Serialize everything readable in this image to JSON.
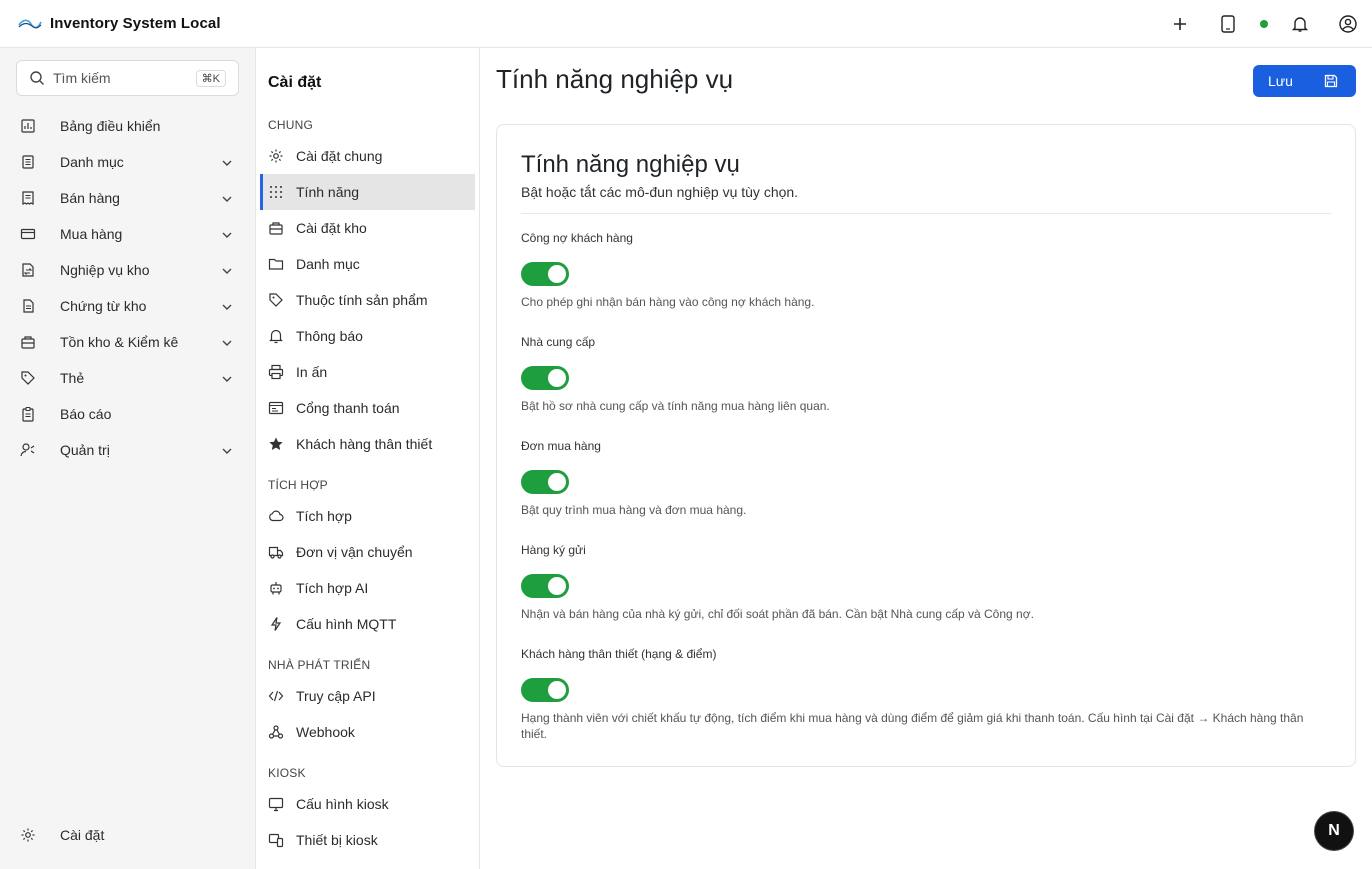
{
  "app": {
    "title": "Inventory System Local"
  },
  "topbar": {
    "icons": [
      "plus-icon",
      "tablet-icon",
      "status-online-dot",
      "bell-icon",
      "user-circle-icon"
    ],
    "status_color": "#1e9e3e"
  },
  "sidebar": {
    "search": {
      "placeholder": "Tìm kiếm",
      "shortcut": "⌘K"
    },
    "items": [
      {
        "label": "Bảng điều khiển",
        "icon": "dashboard-icon",
        "expandable": false
      },
      {
        "label": "Danh mục",
        "icon": "list-icon",
        "expandable": true
      },
      {
        "label": "Bán hàng",
        "icon": "receipt-icon",
        "expandable": true
      },
      {
        "label": "Mua hàng",
        "icon": "credit-card-icon",
        "expandable": true
      },
      {
        "label": "Nghiệp vụ kho",
        "icon": "transfer-icon",
        "expandable": true
      },
      {
        "label": "Chứng từ kho",
        "icon": "document-icon",
        "expandable": true
      },
      {
        "label": "Tồn kho & Kiểm kê",
        "icon": "warehouse-icon",
        "expandable": true
      },
      {
        "label": "Thẻ",
        "icon": "tag-icon",
        "expandable": true
      },
      {
        "label": "Báo cáo",
        "icon": "clipboard-icon",
        "expandable": false
      },
      {
        "label": "Quản trị",
        "icon": "user-settings-icon",
        "expandable": true
      }
    ],
    "footer": {
      "label": "Cài đặt",
      "icon": "gear-icon"
    }
  },
  "settings_nav": {
    "title": "Cài đặt",
    "groups": [
      {
        "label": "CHUNG",
        "items": [
          {
            "label": "Cài đặt chung",
            "icon": "gear-icon",
            "active": false
          },
          {
            "label": "Tính năng",
            "icon": "grid-dots-icon",
            "active": true
          },
          {
            "label": "Cài đặt kho",
            "icon": "warehouse-icon",
            "active": false
          },
          {
            "label": "Danh mục",
            "icon": "folder-icon",
            "active": false
          },
          {
            "label": "Thuộc tính sản phẩm",
            "icon": "tag-icon",
            "active": false
          },
          {
            "label": "Thông báo",
            "icon": "bell-icon",
            "active": false
          },
          {
            "label": "In ấn",
            "icon": "printer-icon",
            "active": false
          },
          {
            "label": "Cổng thanh toán",
            "icon": "payment-gateway-icon",
            "active": false
          },
          {
            "label": "Khách hàng thân thiết",
            "icon": "star-icon",
            "active": false
          }
        ]
      },
      {
        "label": "TÍCH HỢP",
        "items": [
          {
            "label": "Tích hợp",
            "icon": "cloud-icon",
            "active": false
          },
          {
            "label": "Đơn vị vận chuyển",
            "icon": "truck-icon",
            "active": false
          },
          {
            "label": "Tích hợp AI",
            "icon": "robot-icon",
            "active": false
          },
          {
            "label": "Cấu hình MQTT",
            "icon": "lightning-icon",
            "active": false
          }
        ]
      },
      {
        "label": "NHÀ PHÁT TRIỂN",
        "items": [
          {
            "label": "Truy cập API",
            "icon": "code-icon",
            "active": false
          },
          {
            "label": "Webhook",
            "icon": "webhook-icon",
            "active": false
          }
        ]
      },
      {
        "label": "KIOSK",
        "items": [
          {
            "label": "Cấu hình kiosk",
            "icon": "monitor-icon",
            "active": false
          },
          {
            "label": "Thiết bị kiosk",
            "icon": "kiosk-device-icon",
            "active": false
          }
        ]
      }
    ]
  },
  "main": {
    "page_title": "Tính năng nghiệp vụ",
    "save_label": "Lưu",
    "card": {
      "title": "Tính năng nghiệp vụ",
      "description": "Bật hoặc tắt các mô-đun nghiệp vụ tùy chọn.",
      "features": [
        {
          "label": "Công nợ khách hàng",
          "enabled": true,
          "description": "Cho phép ghi nhận bán hàng vào công nợ khách hàng."
        },
        {
          "label": "Nhà cung cấp",
          "enabled": true,
          "description": "Bật hồ sơ nhà cung cấp và tính năng mua hàng liên quan."
        },
        {
          "label": "Đơn mua hàng",
          "enabled": true,
          "description": "Bật quy trình mua hàng và đơn mua hàng."
        },
        {
          "label": "Hàng ký gửi",
          "enabled": true,
          "description": "Nhận và bán hàng của nhà ký gửi, chỉ đối soát phần đã bán. Cần bật Nhà cung cấp và Công nợ."
        },
        {
          "label": "Khách hàng thân thiết (hạng & điểm)",
          "enabled": true,
          "description": "Hạng thành viên với chiết khấu tự động, tích điểm khi mua hàng và dùng điểm để giảm giá khi thanh toán. Cấu hình tại Cài đặt → Khách hàng thân thiết."
        }
      ]
    }
  },
  "fab": {
    "letter": "N"
  },
  "colors": {
    "accent": "#1a5fe0",
    "toggle_on": "#1e9e3e",
    "active_bar": "#2563eb"
  }
}
